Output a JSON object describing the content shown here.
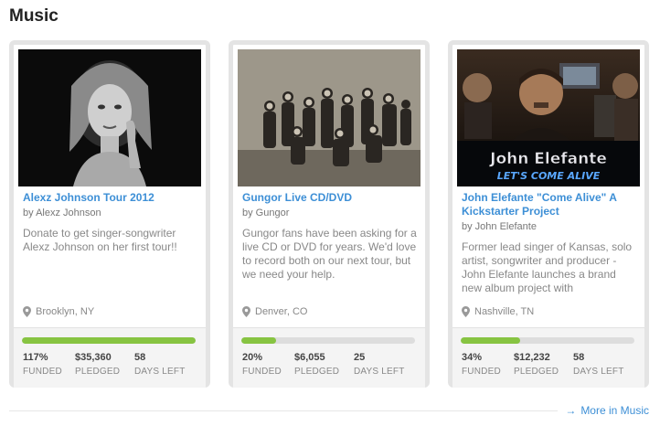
{
  "section": {
    "title": "Music"
  },
  "projects": [
    {
      "title": "Alexz Johnson Tour 2012",
      "byline": "by Alexz Johnson",
      "blurb": "Donate to get singer-songwriter Alexz Johnson on her first tour!!",
      "location": "Brooklyn, NY",
      "progress": 1.0,
      "funded": "117%",
      "pledged": "$35,360",
      "days_left": "58",
      "labels": {
        "funded": "FUNDED",
        "pledged": "PLEDGED",
        "days": "DAYS LEFT"
      }
    },
    {
      "title": "Gungor Live CD/DVD",
      "byline": "by Gungor",
      "blurb": "Gungor fans have been asking for a live CD or DVD for years. We'd love to record both on our next tour, but we need your help.",
      "location": "Denver, CO",
      "progress": 0.2,
      "funded": "20%",
      "pledged": "$6,055",
      "days_left": "25",
      "labels": {
        "funded": "FUNDED",
        "pledged": "PLEDGED",
        "days": "DAYS LEFT"
      }
    },
    {
      "title": "John Elefante \"Come Alive\" A Kickstarter Project",
      "byline": "by John Elefante",
      "blurb": "Former lead singer of Kansas, solo artist, songwriter and producer - John Elefante launches a brand new album project with",
      "location": "Nashville, TN",
      "progress": 0.34,
      "funded": "34%",
      "pledged": "$12,232",
      "days_left": "58",
      "labels": {
        "funded": "FUNDED",
        "pledged": "PLEDGED",
        "days": "DAYS LEFT"
      },
      "image_text": {
        "name": "John Elefante",
        "tagline": "LET'S COME ALIVE"
      }
    }
  ],
  "more": {
    "arrow": "→",
    "label": "More in Music"
  },
  "colors": {
    "link": "#3d8fd6",
    "progress_fill": "#87c442",
    "progress_track": "#dddddd"
  },
  "icons": {
    "location": "map-pin-icon",
    "more": "arrow-right-icon"
  }
}
